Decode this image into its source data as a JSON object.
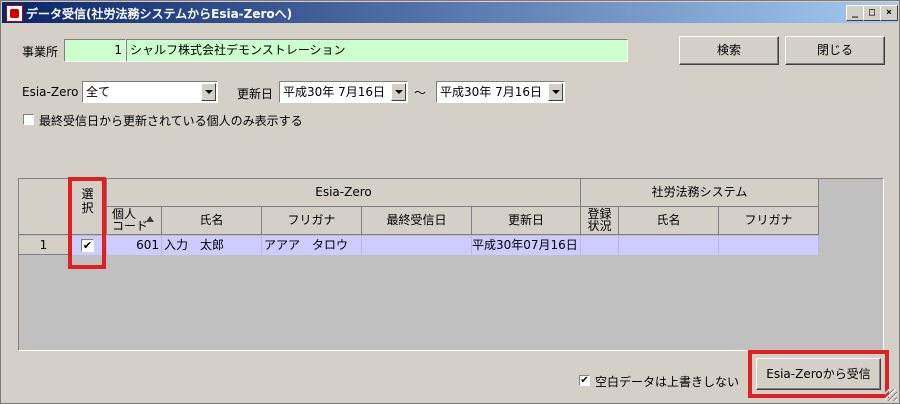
{
  "window": {
    "title": "データ受信(社労法務システムからEsia-Zeroへ)",
    "controls": [
      "_",
      "□",
      "×"
    ]
  },
  "form": {
    "office_label": "事業所",
    "office_code": "1",
    "office_name": "シャルフ株式会社デモンストレーション",
    "search_button": "検索",
    "close_button": "閉じる",
    "esia_label": "Esia-Zero",
    "esia_value": "全て",
    "update_label": "更新日",
    "date_from": "平成30年 7月16日",
    "tilde": "～",
    "date_to": "平成30年 7月16日",
    "filter_checkbox_label": "最終受信日から更新されている個人のみ表示する",
    "filter_checked": false
  },
  "grid": {
    "group_esia": "Esia-Zero",
    "group_sharou": "社労法務システム",
    "col_select": "選\n択",
    "col_code": "個人\nコード",
    "col_name": "氏名",
    "col_kana": "フリガナ",
    "col_last_received": "最終受信日",
    "col_updated": "更新日",
    "col_reg_status": "登録\n状況",
    "col_s_name": "氏名",
    "col_s_kana": "フリガナ",
    "rows": [
      {
        "num": "1",
        "checked": true,
        "code": "601",
        "name": "入力　太郎",
        "kana": "アアア　タロウ",
        "last_received": "",
        "updated": "平成30年07月16日",
        "reg_status": "",
        "s_name": "",
        "s_kana": ""
      }
    ]
  },
  "footer": {
    "blank_checkbox_label": "空白データは上書きしない",
    "blank_checked": true,
    "receive_button": "Esia-Zeroから受信"
  },
  "colors": {
    "window_bg": "#d4d0c8",
    "title_gradient_start": "#0a246a",
    "code_field_bg": "#ccffcc",
    "selected_row_bg": "#ccccff",
    "highlight_box": "#e02020"
  }
}
